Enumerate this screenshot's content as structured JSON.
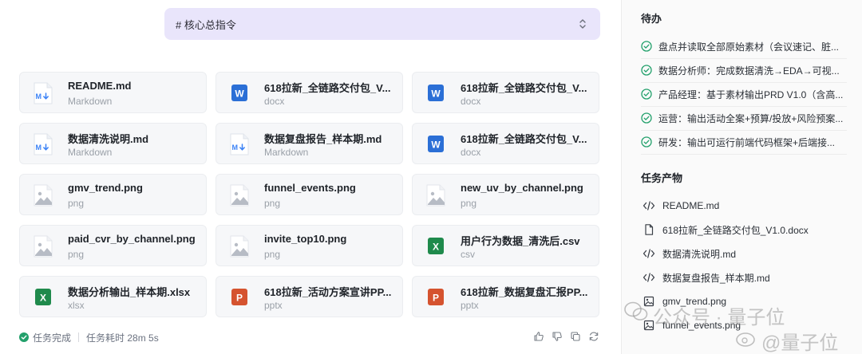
{
  "section": {
    "title": "# 核心总指令"
  },
  "files": [
    {
      "name": "README.md",
      "type": "Markdown",
      "icon": "markdown-file-icon",
      "kind": "md"
    },
    {
      "name": "618拉新_全链路交付包_V...",
      "type": "docx",
      "icon": "word-file-icon",
      "kind": "docx"
    },
    {
      "name": "618拉新_全链路交付包_V...",
      "type": "docx",
      "icon": "word-file-icon",
      "kind": "docx"
    },
    {
      "name": "数据清洗说明.md",
      "type": "Markdown",
      "icon": "markdown-file-icon",
      "kind": "md"
    },
    {
      "name": "数据复盘报告_样本期.md",
      "type": "Markdown",
      "icon": "markdown-file-icon",
      "kind": "md"
    },
    {
      "name": "618拉新_全链路交付包_V...",
      "type": "docx",
      "icon": "word-file-icon",
      "kind": "docx"
    },
    {
      "name": "gmv_trend.png",
      "type": "png",
      "icon": "image-file-icon",
      "kind": "png"
    },
    {
      "name": "funnel_events.png",
      "type": "png",
      "icon": "image-file-icon",
      "kind": "png"
    },
    {
      "name": "new_uv_by_channel.png",
      "type": "png",
      "icon": "image-file-icon",
      "kind": "png"
    },
    {
      "name": "paid_cvr_by_channel.png",
      "type": "png",
      "icon": "image-file-icon",
      "kind": "png"
    },
    {
      "name": "invite_top10.png",
      "type": "png",
      "icon": "image-file-icon",
      "kind": "png"
    },
    {
      "name": "用户行为数据_清洗后.csv",
      "type": "csv",
      "icon": "excel-file-icon",
      "kind": "xls"
    },
    {
      "name": "数据分析输出_样本期.xlsx",
      "type": "xlsx",
      "icon": "excel-file-icon",
      "kind": "xls"
    },
    {
      "name": "618拉新_活动方案宣讲PP...",
      "type": "pptx",
      "icon": "powerpoint-file-icon",
      "kind": "ppt"
    },
    {
      "name": "618拉新_数据复盘汇报PP...",
      "type": "pptx",
      "icon": "powerpoint-file-icon",
      "kind": "ppt"
    }
  ],
  "footer": {
    "status": "任务完成",
    "elapsed": "任务耗时 28m 5s"
  },
  "sidebar": {
    "todo_title": "待办",
    "todos": [
      "盘点并读取全部原始素材（会议速记、脏...",
      "数据分析师：完成数据清洗→EDA→可视...",
      "产品经理：基于素材输出PRD V1.0（含高...",
      "运营：输出活动全案+预算/投放+风险预案...",
      "研发：输出可运行前端代码框架+后端接..."
    ],
    "products_title": "任务产物",
    "products": [
      {
        "label": "README.md",
        "icon": "code-icon"
      },
      {
        "label": "618拉新_全链路交付包_V1.0.docx",
        "icon": "document-icon"
      },
      {
        "label": "数据清洗说明.md",
        "icon": "code-icon"
      },
      {
        "label": "数据复盘报告_样本期.md",
        "icon": "code-icon"
      },
      {
        "label": "gmv_trend.png",
        "icon": "image-icon"
      },
      {
        "label": "funnel_events.png",
        "icon": "image-icon"
      }
    ]
  },
  "watermark": {
    "line1": "公众号 · 量子位",
    "line2": "@量子位"
  },
  "colors": {
    "header_bg": "#e9e5fb",
    "markdown": "#3b82f6",
    "word": "#2b6fd6",
    "excel": "#1f8a4c",
    "powerpoint": "#d5532f",
    "success": "#22a06b"
  }
}
